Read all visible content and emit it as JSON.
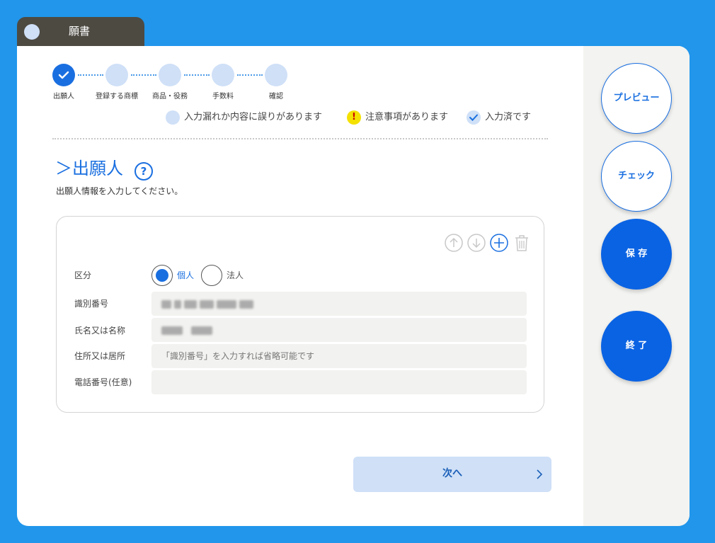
{
  "window": {
    "tab_title": "願書"
  },
  "stepper": {
    "steps": [
      {
        "label": "出願人",
        "state": "done"
      },
      {
        "label": "登録する商標",
        "state": "pending"
      },
      {
        "label": "商品・役務",
        "state": "pending"
      },
      {
        "label": "手数料",
        "state": "pending"
      },
      {
        "label": "確認",
        "state": "pending"
      }
    ]
  },
  "legend": {
    "error": "入力漏れか内容に誤りがあります",
    "warning": "注意事項があります",
    "done": "入力済です",
    "warning_symbol": "!"
  },
  "section": {
    "title": "＞出願人",
    "help": "?",
    "description": "出願人情報を入力してください。"
  },
  "form": {
    "category_label": "区分",
    "category_options": [
      {
        "label": "個人",
        "selected": true
      },
      {
        "label": "法人",
        "selected": false
      }
    ],
    "id_label": "識別番号",
    "id_value_redacted": true,
    "name_label": "氏名又は名称",
    "name_value_redacted": true,
    "address_label": "住所又は居所",
    "address_placeholder": "「識別番号」を入力すれば省略可能です",
    "phone_label": "電話番号(任意)",
    "phone_value": ""
  },
  "actions": {
    "next": "次へ"
  },
  "side": {
    "preview": "プレビュー",
    "check": "チェック",
    "save": "保 存",
    "exit": "終 了"
  },
  "colors": {
    "background": "#2196eb",
    "accent": "#1a6fe0",
    "pending": "#cfe0f7"
  }
}
